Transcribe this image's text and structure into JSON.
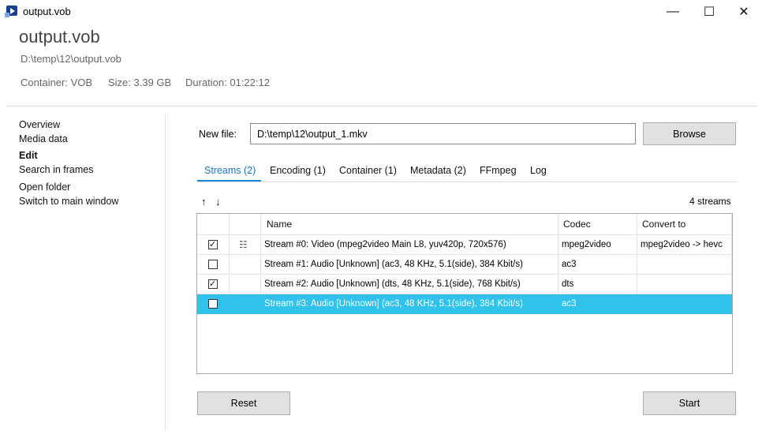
{
  "window": {
    "title": "output.vob",
    "icon": "video-file-icon",
    "minimize_glyph": "—",
    "maximize_glyph": "☐",
    "close_glyph": "✕"
  },
  "header": {
    "title": "output.vob",
    "path": "D:\\temp\\12\\output.vob",
    "container": "Container:  VOB",
    "size": "Size:  3.39 GB",
    "duration": "Duration:  01:22:12"
  },
  "sidebar": {
    "items": [
      {
        "label": "Overview",
        "active": false
      },
      {
        "label": "Media data",
        "active": false
      },
      {
        "label": "Edit",
        "active": true
      },
      {
        "label": "Search in frames",
        "active": false
      },
      {
        "label": "Open folder",
        "active": false
      },
      {
        "label": "Switch to main window",
        "active": false
      }
    ]
  },
  "edit": {
    "new_file_label": "New file:",
    "new_file_value": "D:\\temp\\12\\output_1.mkv",
    "browse_label": "Browse",
    "tabs": [
      {
        "label": "Streams (2)",
        "active": true
      },
      {
        "label": "Encoding (1)",
        "active": false
      },
      {
        "label": "Container (1)",
        "active": false
      },
      {
        "label": "Metadata (2)",
        "active": false
      },
      {
        "label": "FFmpeg",
        "active": false
      },
      {
        "label": "Log",
        "active": false
      }
    ],
    "move_up_glyph": "↑",
    "move_down_glyph": "↓",
    "stream_count": "4 streams",
    "columns": [
      "Name",
      "Codec",
      "Convert to"
    ],
    "menu_glyph": "☷",
    "rows": [
      {
        "checked": true,
        "has_menu": true,
        "name": "Stream #0: Video (mpeg2video Main L8, yuv420p, 720x576)",
        "codec": "mpeg2video",
        "convert": "mpeg2video -> hevc",
        "selected": false
      },
      {
        "checked": false,
        "has_menu": false,
        "name": "Stream #1: Audio  [Unknown] (ac3, 48 KHz, 5.1(side), 384 Kbit/s)",
        "codec": "ac3",
        "convert": "",
        "selected": false
      },
      {
        "checked": true,
        "has_menu": false,
        "name": "Stream #2: Audio  [Unknown] (dts, 48 KHz, 5.1(side), 768 Kbit/s)",
        "codec": "dts",
        "convert": "",
        "selected": false
      },
      {
        "checked": false,
        "has_menu": false,
        "name": "Stream #3: Audio  [Unknown] (ac3, 48 KHz, 5.1(side), 384 Kbit/s)",
        "codec": "ac3",
        "convert": "",
        "selected": true
      }
    ],
    "reset_label": "Reset",
    "start_label": "Start"
  },
  "colors": {
    "accent": "#1a8ad4",
    "selection": "#30c2ea"
  }
}
